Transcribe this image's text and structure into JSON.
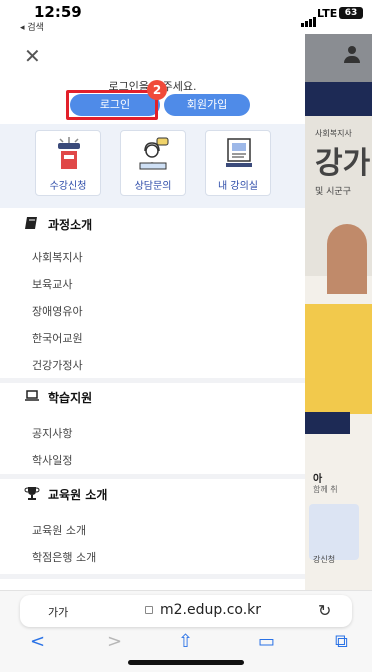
{
  "status_bar": {
    "time": "12:59",
    "back_label": "◂ 검색",
    "network": "LTE",
    "battery": "63"
  },
  "drawer": {
    "close_icon": "close-icon",
    "login_prompt": "로그인을 해주세요.",
    "login_label": "로그인",
    "join_label": "회원가입",
    "step_badge": "2",
    "quick_links": [
      {
        "label": "수강신청",
        "icon": "course-register-icon"
      },
      {
        "label": "상담문의",
        "icon": "consult-icon"
      },
      {
        "label": "내 강의실",
        "icon": "classroom-icon"
      }
    ],
    "sections": [
      {
        "title": "과정소개",
        "icon": "book-icon",
        "items": [
          "사회복지사",
          "보육교사",
          "장애영유아",
          "한국어교원",
          "건강가정사"
        ]
      },
      {
        "title": "학습지원",
        "icon": "laptop-icon",
        "items": [
          "공지사항",
          "학사일정"
        ]
      },
      {
        "title": "교육원 소개",
        "icon": "trophy-icon",
        "items": [
          "교육원 소개",
          "학점은행 소개"
        ]
      }
    ]
  },
  "background_page": {
    "banner_small": "사회복지사",
    "banner_big": "강가",
    "banner_sub": "및 시군구",
    "promo_title": "아",
    "promo_sub": "함께 취",
    "tile_label": "강신청"
  },
  "safari": {
    "text_size_label": "가가",
    "url": "m2.edup.co.kr",
    "reload_glyph": "↻",
    "toolbar": [
      {
        "name": "back-arrow-icon",
        "glyph": "<"
      },
      {
        "name": "forward-arrow-icon",
        "glyph": ">"
      },
      {
        "name": "share-icon",
        "glyph": "⇧"
      },
      {
        "name": "bookmarks-icon",
        "glyph": "▭"
      },
      {
        "name": "tabs-icon",
        "glyph": "⧉"
      }
    ]
  },
  "colors": {
    "accent": "#4f8be8",
    "highlight_box": "#e2202a",
    "badge": "#f04a3a",
    "quick_label": "#2b4aa8",
    "navy": "#1d2a55"
  }
}
